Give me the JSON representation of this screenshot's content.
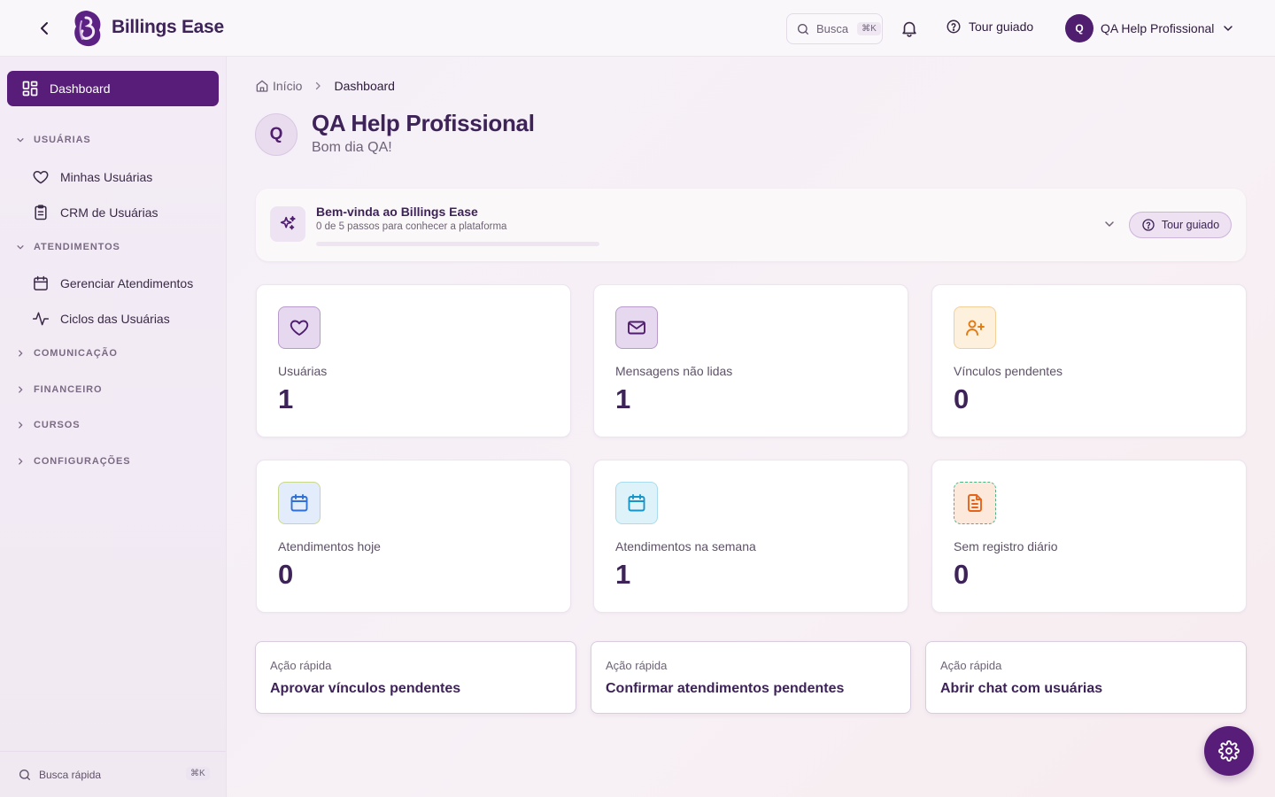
{
  "app": {
    "brand": "Billings Ease"
  },
  "topbar": {
    "search_label": "Busca",
    "search_shortcut": "⌘K",
    "tour_label": "Tour guiado",
    "user_initial": "Q",
    "user_name": "QA Help Profissional"
  },
  "sidebar": {
    "dashboard_label": "Dashboard",
    "sections": {
      "usuarias": "USUÁRIAS",
      "atendimentos": "ATENDIMENTOS",
      "comunicacao": "COMUNICAÇÃO",
      "financeiro": "FINANCEIRO",
      "cursos": "CURSOS",
      "configuracoes": "CONFIGURAÇÕES"
    },
    "items": {
      "minhas_usuarias": "Minhas Usuárias",
      "crm_usuarias": "CRM de Usuárias",
      "gerenciar_atendimentos": "Gerenciar Atendimentos",
      "ciclos_usuarias": "Ciclos das Usuárias"
    },
    "quick_search_label": "Busca rápida",
    "quick_search_shortcut": "⌘K"
  },
  "breadcrumb": {
    "home": "Início",
    "current": "Dashboard"
  },
  "header": {
    "avatar_initial": "Q",
    "title": "QA Help Profissional",
    "greeting": "Bom dia QA!"
  },
  "welcome": {
    "title": "Bem-vinda ao Billings Ease",
    "subtitle": "0 de 5 passos para conhecer a plataforma",
    "steps_done": 0,
    "steps_total": 5,
    "tour_label": "Tour guiado"
  },
  "stats": [
    {
      "label": "Usuárias",
      "value": "1",
      "icon": "heart-icon"
    },
    {
      "label": "Mensagens não lidas",
      "value": "1",
      "icon": "mail-icon"
    },
    {
      "label": "Vínculos pendentes",
      "value": "0",
      "icon": "user-plus-icon"
    },
    {
      "label": "Atendimentos hoje",
      "value": "0",
      "icon": "calendar-icon"
    },
    {
      "label": "Atendimentos na semana",
      "value": "1",
      "icon": "calendar-icon"
    },
    {
      "label": "Sem registro diário",
      "value": "0",
      "icon": "document-icon"
    }
  ],
  "quick_actions": [
    {
      "label": "Ação rápida",
      "title": "Aprovar vínculos pendentes"
    },
    {
      "label": "Ação rápida",
      "title": "Confirmar atendimentos pendentes"
    },
    {
      "label": "Ação rápida",
      "title": "Abrir chat com usuárias"
    }
  ],
  "colors": {
    "brand_primary": "#571d79",
    "brand_text": "#3d2357",
    "stat_icon_purple_bg": "#e6d8ee",
    "stat_icon_orange_bg": "#fdf0dd",
    "stat_icon_blue_bg": "#e2ecfb",
    "stat_icon_cyan_bg": "#def2fa",
    "stat_icon_peach_bg": "#fde9dc"
  }
}
